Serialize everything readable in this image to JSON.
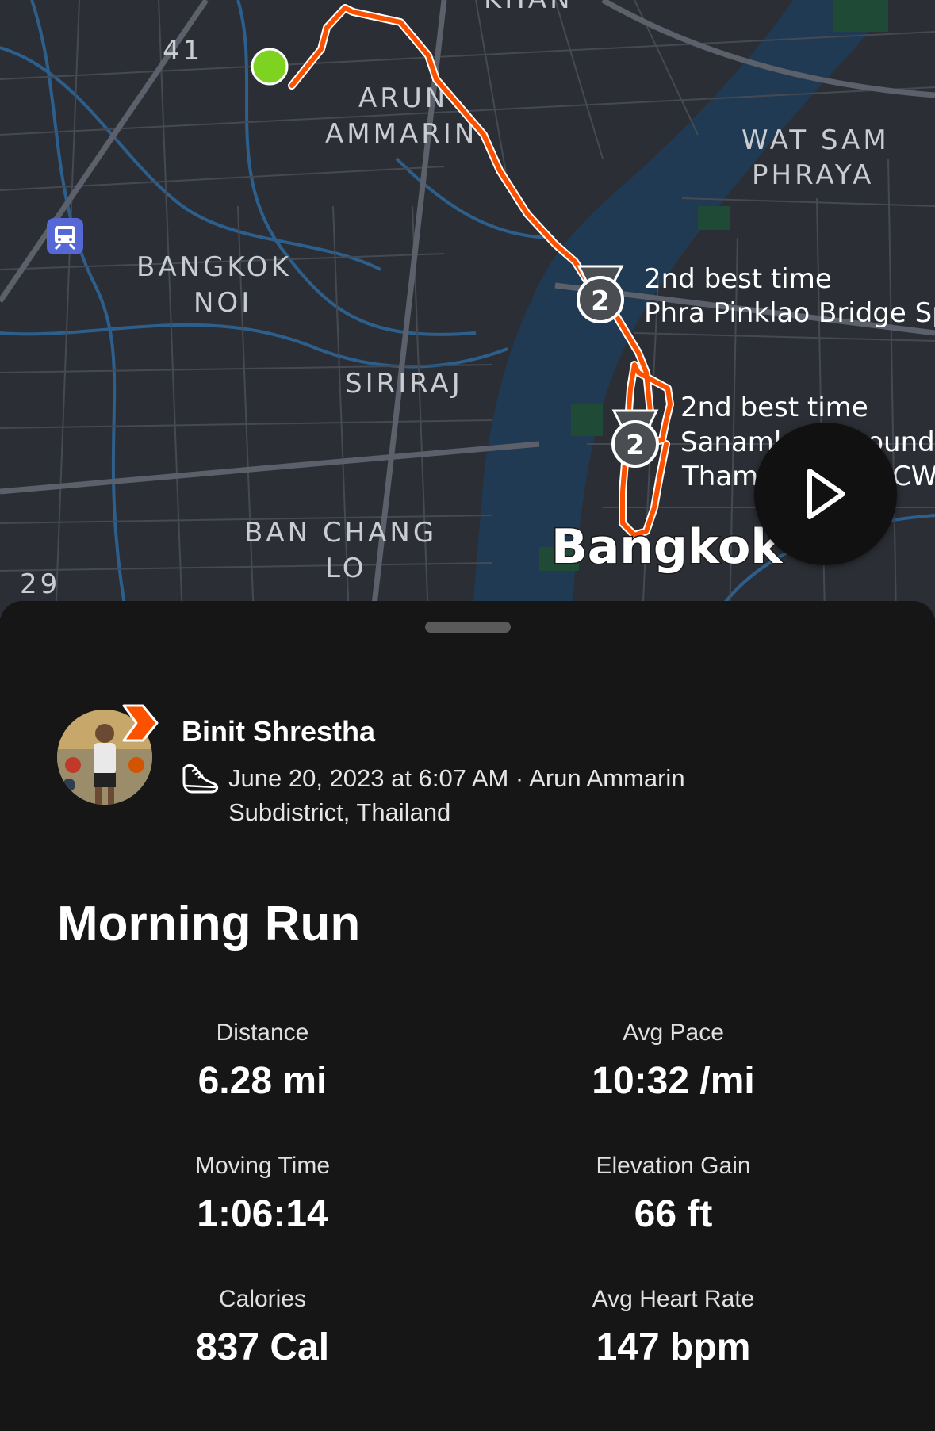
{
  "map": {
    "labels": [
      "41",
      "ARUN",
      "AMMARIN",
      "WAT SAM",
      "PHRAYA",
      "BANGKOK",
      "NOI",
      "SIRIRAJ",
      "BAN CHANG",
      "LO",
      "29",
      "Bangkok",
      "KHAN"
    ],
    "segments": [
      {
        "line1": "2nd best time",
        "line2": "Phra Pinklao Bridge Sp",
        "rank": "2"
      },
      {
        "line1": "2nd best time",
        "line2": "Sanaml",
        "line2b": "round",
        "line3": "Tham",
        "line3b": "CW",
        "rank": "2"
      }
    ],
    "route_color": "#fc5200",
    "start_color": "#7ed321"
  },
  "activity": {
    "athlete_name": "Binit Shrestha",
    "meta_line1": "June 20, 2023 at 6:07 AM · Arun Ammarin",
    "meta_line2": "Subdistrict, Thailand",
    "title": "Morning Run"
  },
  "stats": [
    {
      "label": "Distance",
      "value": "6.28 mi"
    },
    {
      "label": "Avg Pace",
      "value": "10:32 /mi"
    },
    {
      "label": "Moving Time",
      "value": "1:06:14"
    },
    {
      "label": "Elevation Gain",
      "value": "66 ft"
    },
    {
      "label": "Calories",
      "value": "837 Cal"
    },
    {
      "label": "Avg Heart Rate",
      "value": "147 bpm"
    }
  ]
}
